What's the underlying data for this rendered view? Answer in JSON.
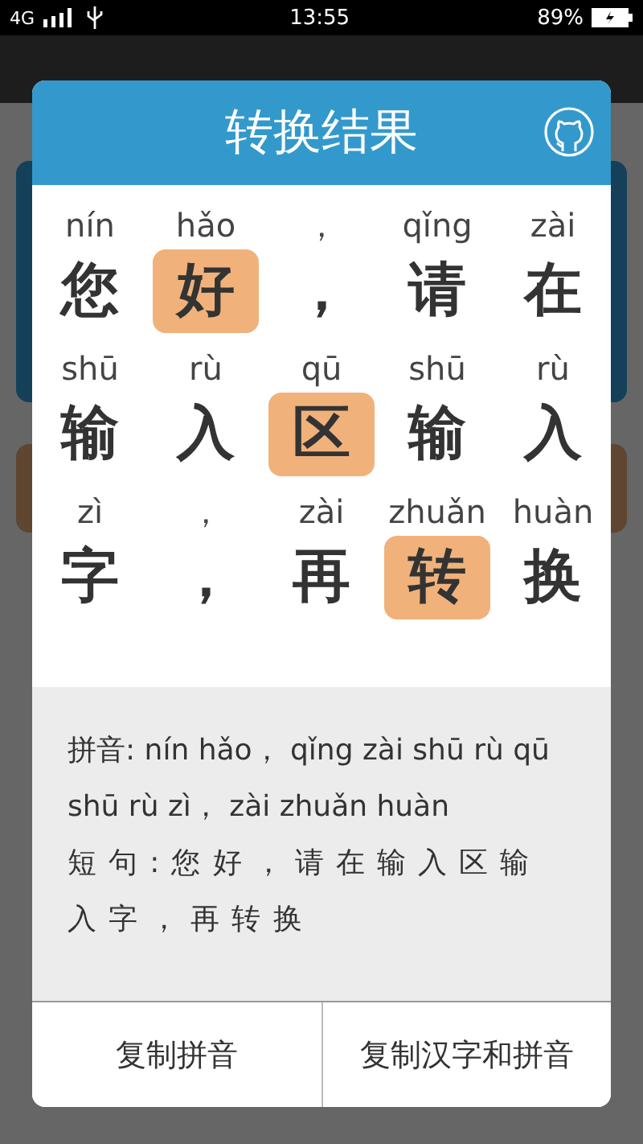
{
  "status_bar": {
    "network": "4G",
    "time": "13:55",
    "battery": "89%"
  },
  "dialog": {
    "title": "转换结果",
    "cells": [
      {
        "pinyin": "nín",
        "hanzi": "您",
        "selected": false
      },
      {
        "pinyin": "hǎo",
        "hanzi": "好",
        "selected": true
      },
      {
        "pinyin": "，",
        "hanzi": "，",
        "selected": false
      },
      {
        "pinyin": "qǐng",
        "hanzi": "请",
        "selected": false
      },
      {
        "pinyin": "zài",
        "hanzi": "在",
        "selected": false
      },
      {
        "pinyin": "shū",
        "hanzi": "输",
        "selected": false
      },
      {
        "pinyin": "rù",
        "hanzi": "入",
        "selected": false
      },
      {
        "pinyin": "qū",
        "hanzi": "区",
        "selected": true
      },
      {
        "pinyin": "shū",
        "hanzi": "输",
        "selected": false
      },
      {
        "pinyin": "rù",
        "hanzi": "入",
        "selected": false
      },
      {
        "pinyin": "zì",
        "hanzi": "字",
        "selected": false
      },
      {
        "pinyin": "，",
        "hanzi": "，",
        "selected": false
      },
      {
        "pinyin": "zài",
        "hanzi": "再",
        "selected": false
      },
      {
        "pinyin": "zhuǎn",
        "hanzi": "转",
        "selected": true
      },
      {
        "pinyin": "huàn",
        "hanzi": "换",
        "selected": false
      }
    ],
    "summary": [
      "拼音: nín hǎo， qǐng zài shū rù qū shū rù zì， zài zhuǎn huàn",
      "短句:您好，请在输入区输入字，再转换"
    ],
    "buttons": [
      "复制拼音",
      "复制汉字和拼音"
    ]
  }
}
